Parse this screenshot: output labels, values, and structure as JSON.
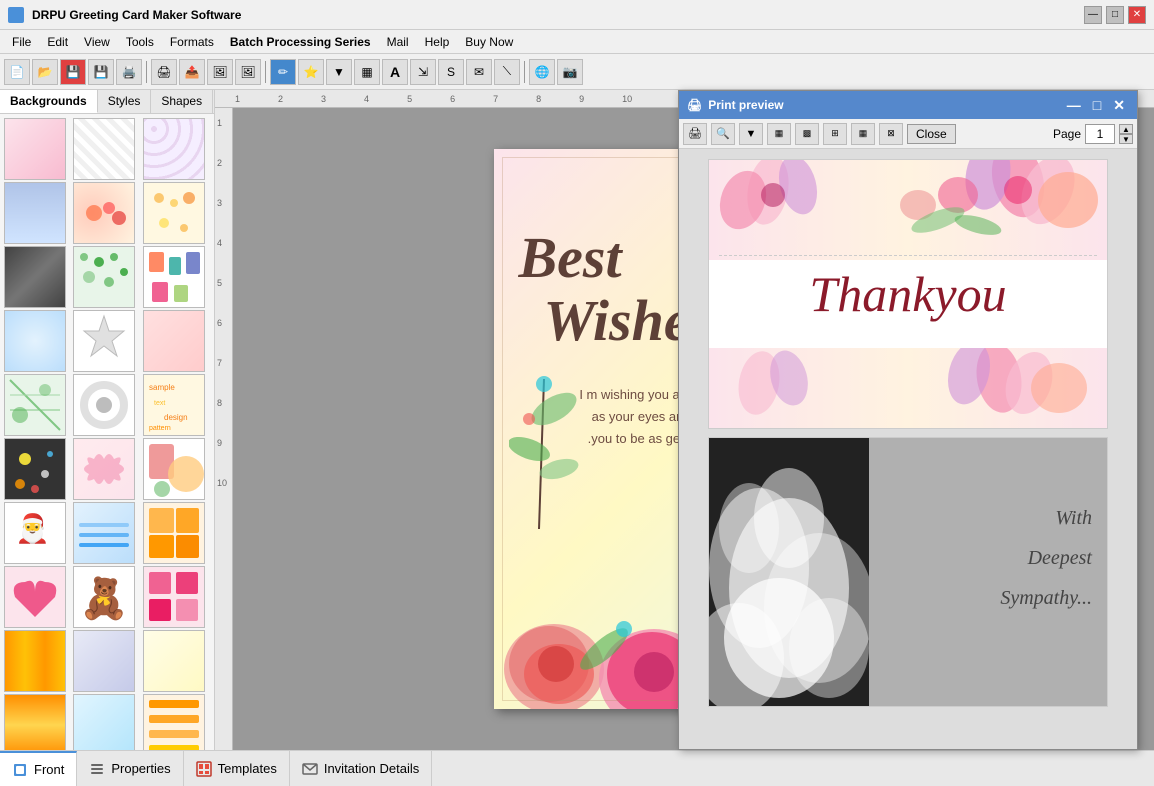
{
  "app": {
    "title": "DRPU Greeting Card Maker Software",
    "title_icon": "🎴"
  },
  "title_bar": {
    "minimize": "—",
    "maximize": "□",
    "close": "✕"
  },
  "menu": {
    "items": [
      "File",
      "Edit",
      "View",
      "Tools",
      "Formats",
      "Batch Processing Series",
      "Mail",
      "Help",
      "Buy Now"
    ]
  },
  "panel_tabs": {
    "tabs": [
      "Backgrounds",
      "Styles",
      "Shapes"
    ]
  },
  "card": {
    "text_best": "Best",
    "text_wishes": "Wishes",
    "body_text": "I m wishing you a day which is as bright\nas your eyes and every one around\n.you to be as generous as your heart"
  },
  "print_preview": {
    "title": "Print preview",
    "close_label": "Close",
    "page_label": "Page",
    "page_number": "1",
    "card1_text": "Thankyou",
    "card2_line1": "With",
    "card2_line2": "Deepest",
    "card2_line3": "Sympathy..."
  },
  "bottom_tabs": {
    "tabs": [
      {
        "id": "front",
        "label": "Front",
        "active": true
      },
      {
        "id": "properties",
        "label": "Properties",
        "active": false
      },
      {
        "id": "templates",
        "label": "Templates",
        "active": false
      },
      {
        "id": "invitation",
        "label": "Invitation Details",
        "active": false
      }
    ]
  },
  "ruler": {
    "h_ticks": [
      "1",
      "2",
      "3",
      "4",
      "5",
      "6",
      "7",
      "8",
      "9",
      "10"
    ],
    "v_ticks": [
      "1",
      "2",
      "3",
      "4",
      "5",
      "6",
      "7",
      "8",
      "9",
      "10"
    ]
  },
  "colors": {
    "accent": "#4a90d9",
    "card_text": "#5d4037",
    "thankyou_color": "#8b1a2a"
  }
}
